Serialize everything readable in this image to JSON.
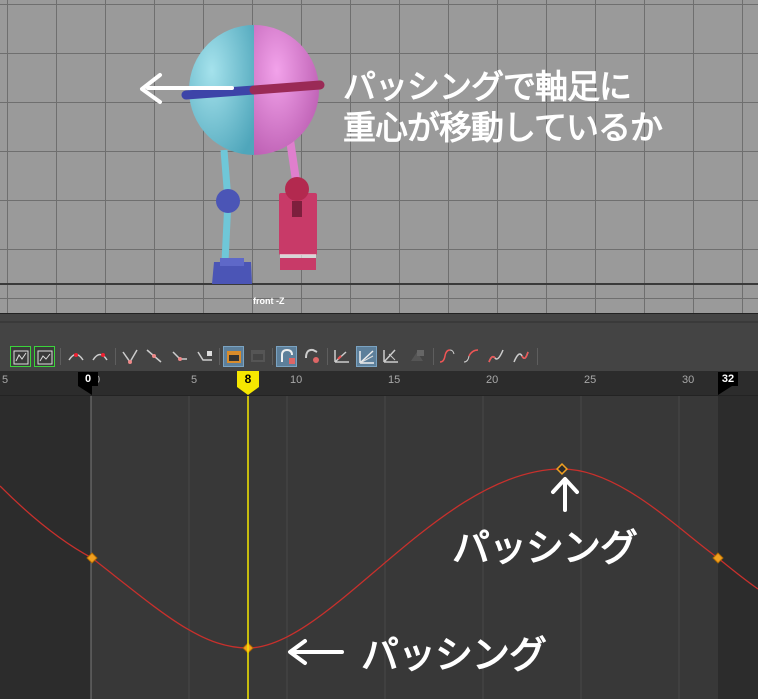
{
  "viewport": {
    "camera_label": "front -Z",
    "annotation_line1": "パッシングで軸足に",
    "annotation_line2": "重心が移動しているか"
  },
  "toolbar": {
    "buttons": [
      {
        "name": "frame-all-icon",
        "active": false
      },
      {
        "name": "frame-selection-icon",
        "active": false
      },
      {
        "name": "center-current-time-icon",
        "active": false
      },
      {
        "name": "auto-tangent-icon",
        "active": false
      },
      {
        "name": "spline-tangent-icon",
        "active": false
      },
      {
        "name": "linear-tangent-icon",
        "active": false
      },
      {
        "name": "flat-tangent-icon",
        "active": false
      },
      {
        "name": "step-tangent-icon",
        "active": false
      },
      {
        "name": "buffer-curve-icon",
        "active": true
      },
      {
        "name": "swap-buffer-icon",
        "active": false
      },
      {
        "name": "break-tangents-icon",
        "active": true
      },
      {
        "name": "unify-tangents-icon",
        "active": false
      },
      {
        "name": "free-tangent-weight-icon",
        "active": false
      },
      {
        "name": "lock-tangent-weight-icon",
        "active": true
      },
      {
        "name": "time-snap-icon",
        "active": false
      },
      {
        "name": "value-snap-icon",
        "active": false
      },
      {
        "name": "pre-infinity-icon",
        "active": false
      },
      {
        "name": "post-infinity-icon",
        "active": false
      },
      {
        "name": "pre-cycle-icon",
        "active": false
      },
      {
        "name": "post-cycle-icon",
        "active": false
      }
    ]
  },
  "time_ruler": {
    "labels": [
      "5",
      "0",
      "5",
      "10",
      "15",
      "20",
      "25",
      "30"
    ],
    "start_marker": "0",
    "end_marker": "32",
    "current_frame": "8"
  },
  "graph": {
    "annotation_peak": "パッシング",
    "annotation_trough": "パッシング",
    "curve_color": "#c8302c",
    "key_color": "#f0a020",
    "current_time_color": "#f6e700"
  },
  "colors": {
    "body_cyan": "#7ac9d6",
    "body_pink": "#d77fcf",
    "leg_blue": "#4a5fc0",
    "leg_red": "#c43a6a"
  }
}
